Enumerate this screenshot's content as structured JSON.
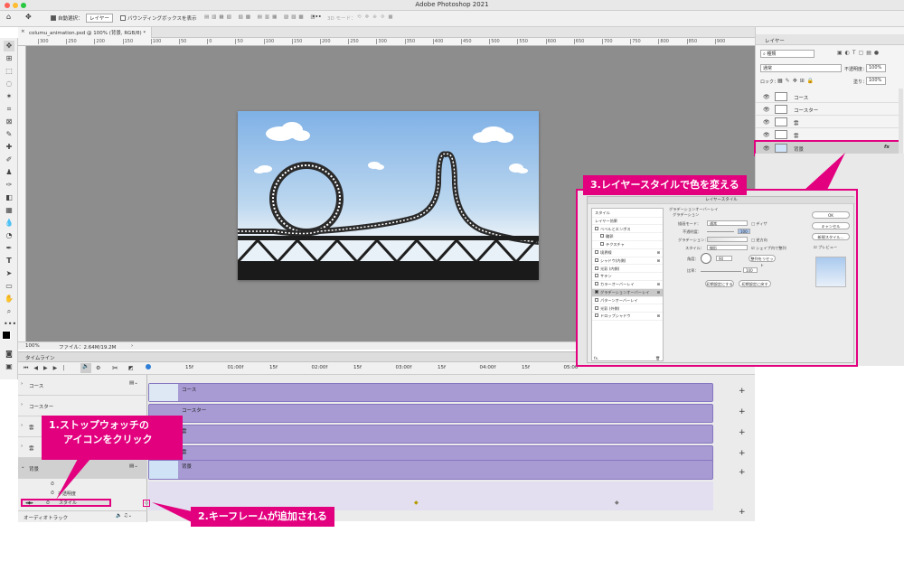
{
  "app": {
    "title": "Adobe Photoshop 2021"
  },
  "options_bar": {
    "auto_select_label": "自動選択：",
    "layer_select": "レイヤー",
    "bounding_box_label": "バウンディングボックスを表示",
    "three_d_mode": "3D モード："
  },
  "document": {
    "tab_title": "columu_animation.psd @ 100% (背景, RGB/8) *"
  },
  "ruler": {
    "ticks": [
      "300",
      "250",
      "200",
      "150",
      "100",
      "50",
      "0",
      "50",
      "100",
      "150",
      "200",
      "250",
      "300",
      "350",
      "400",
      "450",
      "500",
      "550",
      "600",
      "650",
      "700",
      "750",
      "800",
      "850",
      "900"
    ]
  },
  "status_bar": {
    "zoom": "100%",
    "file_info": "ファイル：2.64M/19.2M"
  },
  "layers_panel": {
    "title": "レイヤー",
    "filter": "種類",
    "blend_mode": "通常",
    "opacity_label": "不透明度：",
    "opacity": "100%",
    "lock_label": "ロック：",
    "fill_label": "塗り：",
    "fill": "100%",
    "layers": [
      "コース",
      "コースター",
      "雲",
      "雲",
      "背景"
    ],
    "fx": "fx"
  },
  "timeline": {
    "title": "タイムライン",
    "time_labels": [
      "15f",
      "01:00f",
      "15f",
      "02:00f",
      "15f",
      "03:00f",
      "15f",
      "04:00f",
      "15f",
      "05:00"
    ],
    "tracks": [
      "コース",
      "コースター",
      "雲",
      "雲",
      "背景"
    ],
    "sub_tracks": [
      "不透明度",
      "スタイル"
    ],
    "audio_track": "オーディオトラック"
  },
  "layer_style_dialog": {
    "title": "レイヤースタイル",
    "section_title": "グラデーションオーバーレイ",
    "subsection": "グラデーション",
    "style_items": [
      "スタイル",
      "レイヤー効果",
      "ベベルとエンボス",
      "輪郭",
      "テクスチャ",
      "境界線",
      "シャドウ(内側)",
      "光彩 (内側)",
      "サテン",
      "カラーオーバーレイ",
      "グラデーションオーバーレイ",
      "パターンオーバーレイ",
      "光彩 (外側)",
      "ドロップシャドウ"
    ],
    "blend_label": "描画モード：",
    "blend_value": "通常",
    "dither_label": "ディザ",
    "opacity_label": "不透明度：",
    "opacity_value": "100",
    "reverse_label": "逆方向",
    "gradient_label": "グラデーション：",
    "style_label": "スタイル：",
    "style_value": "線形",
    "align_label": "シェイプ内で整列",
    "angle_label": "角度：",
    "angle_value": "90",
    "reset_align": "整列をリセット",
    "scale_label": "比率：",
    "scale_value": "100",
    "default_btn": "初期設定にする",
    "reset_default_btn": "初期設定に戻す",
    "ok": "OK",
    "cancel": "キャンセル",
    "new_style": "新規スタイル...",
    "preview": "プレビュー",
    "fx": "fx."
  },
  "callouts": {
    "step1_line1": "1.ストップウォッチの",
    "step1_line2": "アイコンをクリック",
    "step2": "2.キーフレームが追加される",
    "step3": "3.レイヤースタイルで色を変える"
  },
  "colors": {
    "accent": "#e3007f",
    "clip": "#a89bd4",
    "canvas": "#8d8d8d"
  }
}
